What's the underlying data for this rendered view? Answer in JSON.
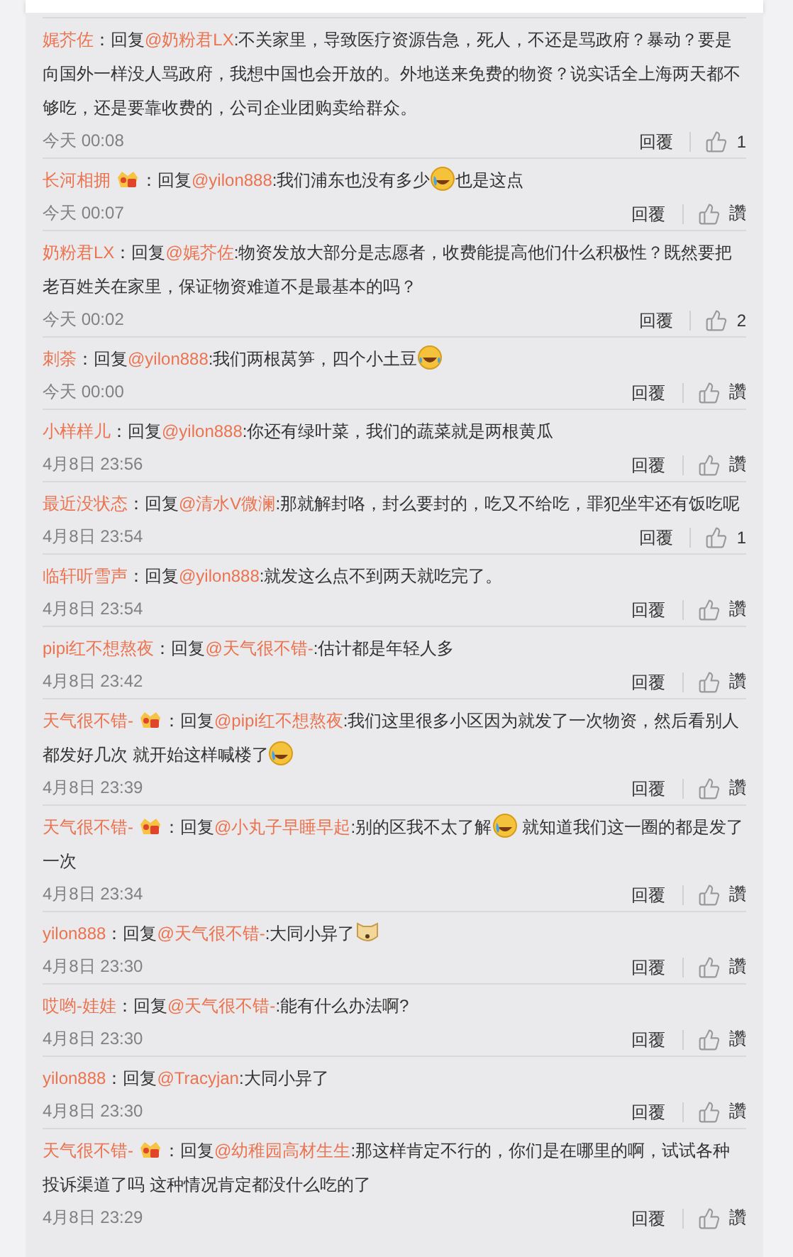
{
  "comments": [
    {
      "author": "娓芥佐",
      "badge": false,
      "reply_label": "：回复",
      "mention": "@奶粉君LX",
      "content": [
        {
          "kind": "text",
          "text": ":不关家里，导致医疗资源告急，死人，不还是骂政府？暴动？要是向国外一样没人骂政府，我想中国也会开放的。外地送来免费的物资？说实话全上海两天都不够吃，还是要靠收费的，公司企业团购卖给群众。"
        }
      ],
      "time": "今天 00:08",
      "reply": "回覆",
      "likes": "1"
    },
    {
      "author": "长河相拥",
      "badge": true,
      "reply_label": "：回复",
      "mention": "@yilon888",
      "content": [
        {
          "kind": "text",
          "text": ":我们浦东也没有多少"
        },
        {
          "kind": "cry"
        },
        {
          "kind": "text",
          "text": "也是这点"
        }
      ],
      "time": "今天 00:07",
      "reply": "回覆",
      "likes": "讚"
    },
    {
      "author": "奶粉君LX",
      "badge": false,
      "reply_label": "：回复",
      "mention": "@娓芥佐",
      "content": [
        {
          "kind": "text",
          "text": ":物资发放大部分是志愿者，收费能提高他们什么积极性？既然要把老百姓关在家里，保证物资难道不是最基本的吗？"
        }
      ],
      "time": "今天 00:02",
      "reply": "回覆",
      "likes": "2"
    },
    {
      "author": "刺荼",
      "badge": false,
      "reply_label": "：回复",
      "mention": "@yilon888",
      "content": [
        {
          "kind": "text",
          "text": ":我们两根莴笋，四个小土豆"
        },
        {
          "kind": "laugh"
        }
      ],
      "time": "今天 00:00",
      "reply": "回覆",
      "likes": "讚"
    },
    {
      "author": "小样样儿",
      "badge": false,
      "reply_label": "：回复",
      "mention": "@yilon888",
      "content": [
        {
          "kind": "text",
          "text": ":你还有绿叶菜，我们的蔬菜就是两根黄瓜"
        }
      ],
      "time": "4月8日 23:56",
      "reply": "回覆",
      "likes": "讚"
    },
    {
      "author": "最近没状态",
      "badge": false,
      "reply_label": "：回复",
      "mention": "@清水V微澜",
      "content": [
        {
          "kind": "text",
          "text": ":那就解封咯，封么要封的，吃又不给吃，罪犯坐牢还有饭吃呢"
        }
      ],
      "time": "4月8日 23:54",
      "reply": "回覆",
      "likes": "1"
    },
    {
      "author": "临轩听雪声",
      "badge": false,
      "reply_label": "：回复",
      "mention": "@yilon888",
      "content": [
        {
          "kind": "text",
          "text": ":就发这么点不到两天就吃完了。"
        }
      ],
      "time": "4月8日 23:54",
      "reply": "回覆",
      "likes": "讚"
    },
    {
      "author": "pipi红不想熬夜",
      "badge": false,
      "reply_label": "：回复",
      "mention": "@天气很不错-",
      "content": [
        {
          "kind": "text",
          "text": ":估计都是年轻人多"
        }
      ],
      "time": "4月8日 23:42",
      "reply": "回覆",
      "likes": "讚"
    },
    {
      "author": "天气很不错-",
      "badge": true,
      "reply_label": "：回复",
      "mention": "@pipi红不想熬夜",
      "content": [
        {
          "kind": "text",
          "text": ":我们这里很多小区因为就发了一次物资，然后看别人都发好几次 就开始这样喊楼了"
        },
        {
          "kind": "cry"
        }
      ],
      "time": "4月8日 23:39",
      "reply": "回覆",
      "likes": "讚"
    },
    {
      "author": "天气很不错-",
      "badge": true,
      "reply_label": "：回复",
      "mention": "@小丸子早睡早起",
      "content": [
        {
          "kind": "text",
          "text": ":别的区我不太了解"
        },
        {
          "kind": "cry"
        },
        {
          "kind": "text",
          "text": " 就知道我们这一圈的都是发了一次"
        }
      ],
      "time": "4月8日 23:34",
      "reply": "回覆",
      "likes": "讚"
    },
    {
      "author": "yilon888",
      "badge": false,
      "reply_label": "：回复",
      "mention": "@天气很不错-",
      "content": [
        {
          "kind": "text",
          "text": ":大同小异了"
        },
        {
          "kind": "dog"
        }
      ],
      "time": "4月8日 23:30",
      "reply": "回覆",
      "likes": "讚"
    },
    {
      "author": "哎哟-娃娃",
      "badge": false,
      "reply_label": "：回复",
      "mention": "@天气很不错-",
      "content": [
        {
          "kind": "text",
          "text": ":能有什么办法啊?"
        }
      ],
      "time": "4月8日 23:30",
      "reply": "回覆",
      "likes": "讚"
    },
    {
      "author": "yilon888",
      "badge": false,
      "reply_label": "：回复",
      "mention": "@Tracyjan",
      "content": [
        {
          "kind": "text",
          "text": ":大同小异了"
        }
      ],
      "time": "4月8日 23:30",
      "reply": "回覆",
      "likes": "讚"
    },
    {
      "author": "天气很不错-",
      "badge": true,
      "reply_label": "：回复",
      "mention": "@幼稚园高材生生",
      "content": [
        {
          "kind": "text",
          "text": ":那这样肯定不行的，你们是在哪里的啊，试试各种投诉渠道了吗 这种情况肯定都没什么吃的了"
        }
      ],
      "time": "4月8日 23:29",
      "reply": "回覆",
      "likes": "讚"
    }
  ]
}
